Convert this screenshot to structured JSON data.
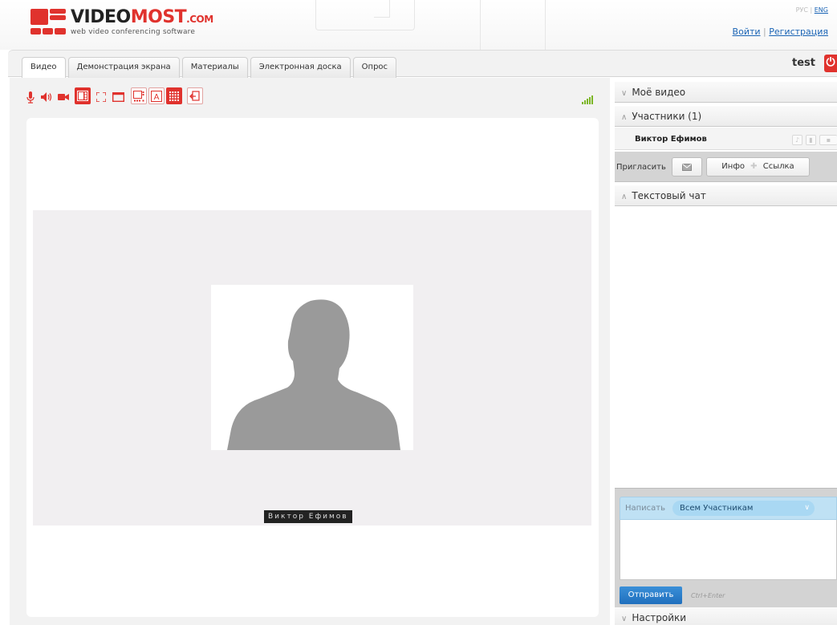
{
  "brand": {
    "name_part1": "VIDEO",
    "name_part2": "MOST",
    "domain": ".COM",
    "tagline": "web video conferencing software",
    "accent": "#e0322d"
  },
  "header": {
    "lang_ru": "РУС",
    "lang_separator": " | ",
    "lang_en": "ENG",
    "login": "Войти",
    "auth_separator": " | ",
    "register": "Регистрация"
  },
  "tabs": [
    {
      "label": "Видео",
      "active": true
    },
    {
      "label": "Демонстрация экрана",
      "active": false
    },
    {
      "label": "Материалы",
      "active": false
    },
    {
      "label": "Электронная доска",
      "active": false
    },
    {
      "label": "Опрос",
      "active": false
    }
  ],
  "user": {
    "name": "test",
    "logout_icon": "power-icon"
  },
  "toolbar": {
    "icons": [
      "microphone-icon",
      "speaker-icon",
      "camera-icon",
      "layout-side-icon",
      "fullscreen-icon",
      "window-icon",
      "layout-grid-small-icon",
      "text-icon",
      "layout-grid-large-icon",
      "exit-icon"
    ],
    "signal_bars": 5,
    "signal_color": "#7cb626"
  },
  "video": {
    "participant_caption": "Виктор Ефимов"
  },
  "right_panel": {
    "my_video": "Моё видео",
    "participants_header": "Участники (1)",
    "participants": [
      {
        "name": "Виктор Ефимов"
      }
    ],
    "invite_label": "Пригласить",
    "info_label": "Инфо",
    "link_label": "Ссылка",
    "text_chat": "Текстовый чат",
    "compose_label": "Написать",
    "recipient": "Всем Участникам",
    "send_label": "Отправить",
    "send_hotkey": "Ctrl+Enter",
    "settings": "Настройки"
  }
}
